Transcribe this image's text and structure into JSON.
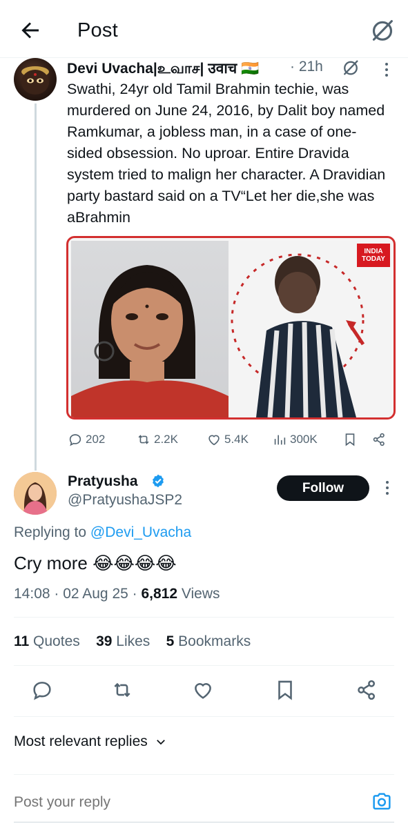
{
  "header": {
    "title": "Post",
    "back_icon": "arrow-left-icon",
    "grok_icon": "grok-icon"
  },
  "parent_post": {
    "author_name": "Devi Uvacha|உவாச| उवाच 🇮🇳",
    "time": "· 21h",
    "text": "Swathi, 24yr old Tamil Brahmin techie, was murdered on June 24, 2016, by Dalit boy named Ramkumar, a jobless man, in a case of one-sided obsession. No uproar. Entire Dravida system tried to malign her character. A Dravidian party bastard said on a TV“Let her die,she was aBrahmin",
    "media_watermark": "INDIA TODAY",
    "actions": {
      "replies": "202",
      "reposts": "2.2K",
      "likes": "5.4K",
      "views": "300K"
    }
  },
  "reply_post": {
    "author_name": "Pratyusha",
    "handle": "@PratyushaJSP2",
    "follow_label": "Follow",
    "replying_prefix": "Replying to ",
    "replying_handle": "@Devi_Uvacha",
    "text": "Cry more 😂😂😂😂",
    "time": "14:08 · 02 Aug 25 · ",
    "views_count": "6,812",
    "views_label": " Views",
    "stats": {
      "quotes_count": "11",
      "quotes_label": " Quotes",
      "likes_count": "39",
      "likes_label": " Likes",
      "bookmarks_count": "5",
      "bookmarks_label": " Bookmarks"
    }
  },
  "sort": {
    "label": "Most relevant replies"
  },
  "composer": {
    "placeholder": "Post your reply"
  },
  "colors": {
    "accent": "#1d9bf0",
    "text": "#0f1419",
    "muted": "#536471",
    "media_border": "#d32f2f"
  }
}
